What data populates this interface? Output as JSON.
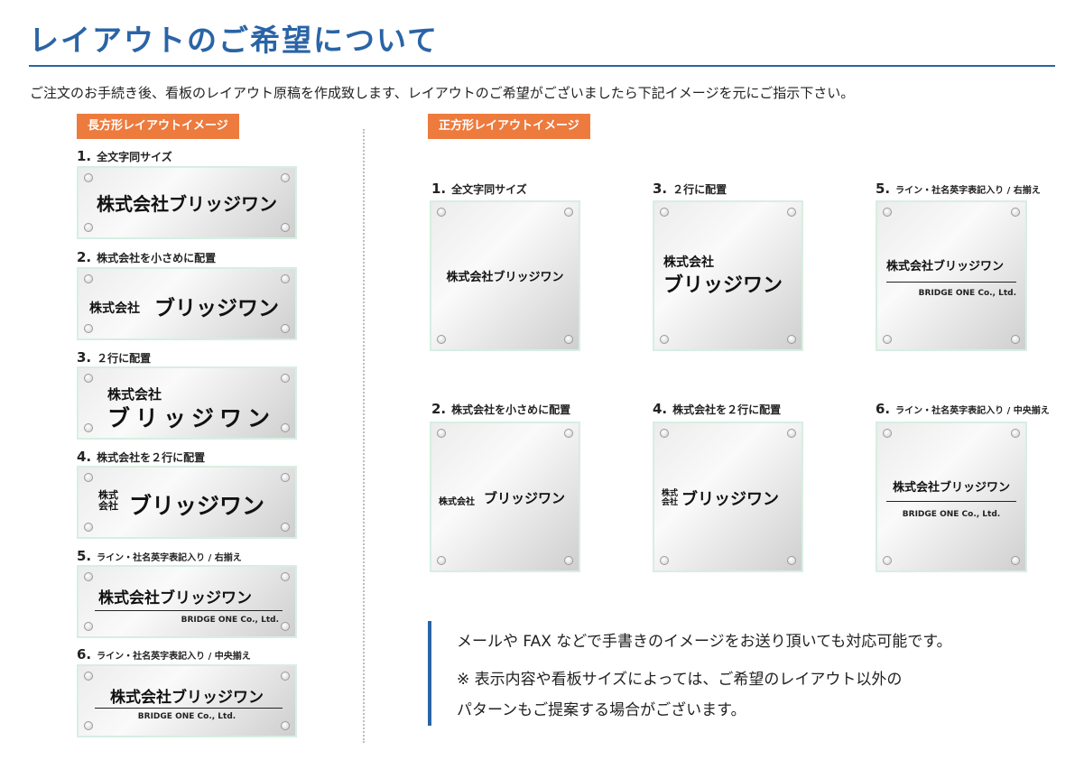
{
  "title": "レイアウトのご希望について",
  "intro": "ご注文のお手続き後、看板のレイアウト原稿を作成致します、レイアウトのご希望がございましたら下記イメージを元にご指示下さい。",
  "rect_section": {
    "label": "長方形レイアウトイメージ",
    "items": [
      {
        "num": "1.",
        "caption": "全文字同サイズ",
        "name": "株式会社ブリッジワン"
      },
      {
        "num": "2.",
        "caption": "株式会社を小さめに配置",
        "small": "株式会社",
        "big": "ブリッジワン"
      },
      {
        "num": "3.",
        "caption": "２行に配置",
        "line1": "株式会社",
        "line2": "ブリッジワン"
      },
      {
        "num": "4.",
        "caption": "株式会社を２行に配置",
        "stack1": "株式",
        "stack2": "会社",
        "big": "ブリッジワン"
      },
      {
        "num": "5.",
        "caption": "ライン・社名英字表記入り / 右揃え",
        "name": "株式会社ブリッジワン",
        "en": "BRIDGE ONE Co., Ltd."
      },
      {
        "num": "6.",
        "caption": "ライン・社名英字表記入り / 中央揃え",
        "name": "株式会社ブリッジワン",
        "en": "BRIDGE ONE Co., Ltd."
      }
    ]
  },
  "square_section": {
    "label": "正方形レイアウトイメージ",
    "items": [
      {
        "num": "1.",
        "caption": "全文字同サイズ",
        "name": "株式会社ブリッジワン"
      },
      {
        "num": "3.",
        "caption": "２行に配置",
        "line1": "株式会社",
        "line2": "ブリッジワン"
      },
      {
        "num": "5.",
        "caption": "ライン・社名英字表記入り / 右揃え",
        "name": "株式会社ブリッジワン",
        "en": "BRIDGE ONE Co., Ltd."
      },
      {
        "num": "2.",
        "caption": "株式会社を小さめに配置",
        "small": "株式会社",
        "big": "ブリッジワン"
      },
      {
        "num": "4.",
        "caption": "株式会社を２行に配置",
        "stack1": "株式",
        "stack2": "会社",
        "big": "ブリッジワン"
      },
      {
        "num": "6.",
        "caption": "ライン・社名英字表記入り / 中央揃え",
        "name": "株式会社ブリッジワン",
        "en": "BRIDGE ONE Co., Ltd."
      }
    ]
  },
  "notes": {
    "line1": "メールや FAX などで手書きのイメージをお送り頂いても対応可能です。",
    "line2": "※ 表示内容や看板サイズによっては、ご希望のレイアウト以外の",
    "line3": "パターンもご提案する場合がございます。"
  },
  "colors": {
    "accent_blue": "#2a64a6",
    "tag_orange": "#ed7b3e",
    "plate_border": "#d7eee2"
  }
}
